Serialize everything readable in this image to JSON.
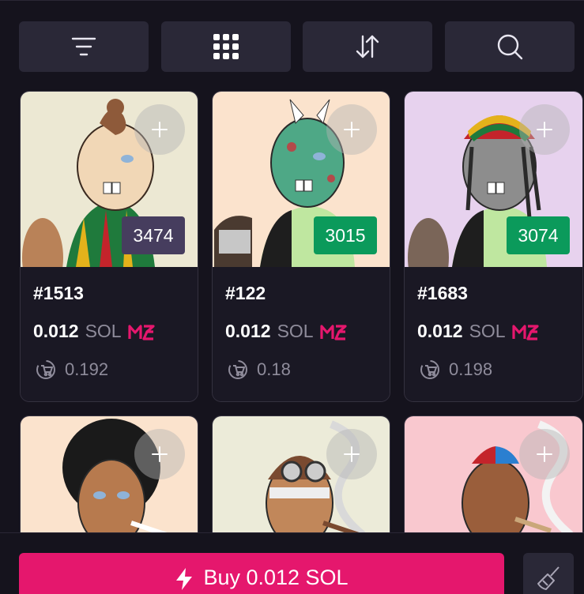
{
  "toolbar": {
    "buttons": [
      {
        "icon": "filter-icon"
      },
      {
        "icon": "grid-view-icon"
      },
      {
        "icon": "sort-icon"
      },
      {
        "icon": "search-icon"
      }
    ]
  },
  "cards": [
    {
      "name": "#1513",
      "rank": "3474",
      "rank_color": "#463d5e",
      "price": "0.012",
      "unit": "SOL",
      "offer": "0.192",
      "bg": "#ece8d3"
    },
    {
      "name": "#122",
      "rank": "3015",
      "rank_color": "#0b9a5b",
      "price": "0.012",
      "unit": "SOL",
      "offer": "0.18",
      "bg": "#fbe3cd"
    },
    {
      "name": "#1683",
      "rank": "3074",
      "rank_color": "#0b9a5b",
      "price": "0.012",
      "unit": "SOL",
      "offer": "0.198",
      "bg": "#e7d2ee"
    },
    {
      "bg": "#fbe3cd"
    },
    {
      "bg": "#ecebd9"
    },
    {
      "bg": "#f9c8cf"
    }
  ],
  "footer": {
    "buy_label": "Buy 0.012 SOL",
    "buy_color": "#e5176d"
  }
}
